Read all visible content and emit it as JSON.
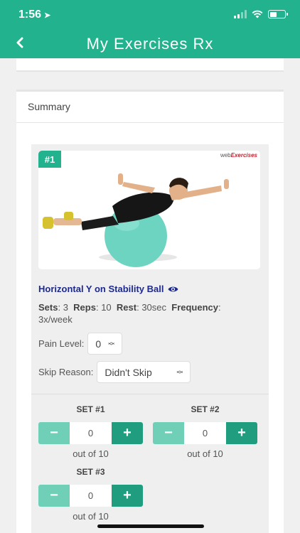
{
  "status": {
    "time": "1:56"
  },
  "header": {
    "title": "My Exercises Rx"
  },
  "summary": {
    "title": "Summary"
  },
  "exercise": {
    "number": "#1",
    "logo_prefix": "web",
    "logo_brand": "Exercises",
    "name": "Horizontal Y on Stability Ball",
    "sets_label": "Sets",
    "sets_value": "3",
    "reps_label": "Reps",
    "reps_value": "10",
    "rest_label": "Rest",
    "rest_value": "30sec",
    "frequency_label": "Frequency",
    "frequency_value": "3x/week",
    "pain_label": "Pain Level:",
    "pain_value": "0",
    "skip_label": "Skip Reason:",
    "skip_value": "Didn't Skip"
  },
  "sets": [
    {
      "label": "SET #1",
      "value": "0",
      "minus": "−",
      "plus": "+",
      "outof": "out of 10"
    },
    {
      "label": "SET #2",
      "value": "0",
      "minus": "−",
      "plus": "+",
      "outof": "out of 10"
    },
    {
      "label": "SET #3",
      "value": "0",
      "minus": "−",
      "plus": "+",
      "outof": "out of 10"
    }
  ],
  "colors": {
    "brand": "#22b28e",
    "button_dark": "#1f9d7e",
    "button_light": "#6fd0b7",
    "link": "#1d2a8c"
  }
}
